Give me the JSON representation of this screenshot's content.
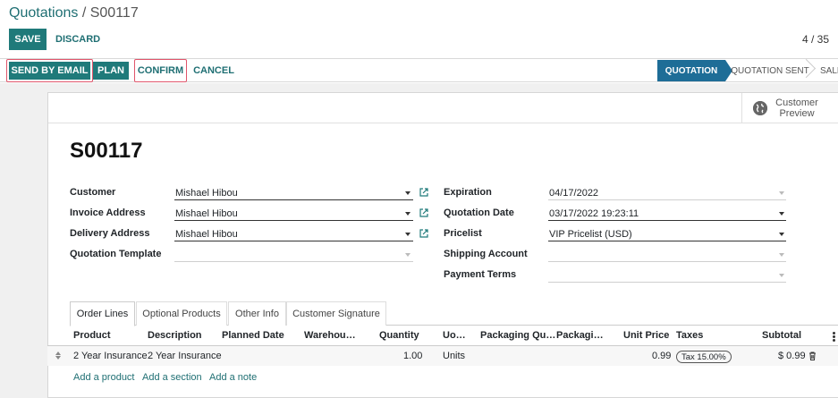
{
  "breadcrumb": {
    "parent": "Quotations",
    "separator": " / ",
    "current": "S00117"
  },
  "control": {
    "save": "SAVE",
    "discard": "DISCARD",
    "pager": "4 / 35"
  },
  "actions": {
    "send_email": "SEND BY EMAIL",
    "plan": "PLAN",
    "confirm": "CONFIRM",
    "cancel": "CANCEL"
  },
  "statusbar": {
    "stages": [
      "QUOTATION",
      "QUOTATION SENT",
      "SALES ORDER"
    ],
    "active": "QUOTATION"
  },
  "preview": {
    "label": "Customer Preview"
  },
  "record": {
    "name": "S00117"
  },
  "fields_left": [
    {
      "label": "Customer",
      "value": "Mishael Hibou"
    },
    {
      "label": "Invoice Address",
      "value": "Mishael Hibou"
    },
    {
      "label": "Delivery Address",
      "value": "Mishael Hibou"
    },
    {
      "label": "Quotation Template",
      "value": ""
    }
  ],
  "fields_right": [
    {
      "label": "Expiration",
      "value": "04/17/2022"
    },
    {
      "label": "Quotation Date",
      "value": "03/17/2022 19:23:11"
    },
    {
      "label": "Pricelist",
      "value": "VIP Pricelist (USD)"
    },
    {
      "label": "Shipping Account",
      "value": ""
    },
    {
      "label": "Payment Terms",
      "value": ""
    }
  ],
  "tabs": [
    "Order Lines",
    "Optional Products",
    "Other Info",
    "Customer Signature"
  ],
  "table": {
    "columns": [
      "Product",
      "Description",
      "Planned Date",
      "Warehou…",
      "Quantity",
      "Uo…",
      "Packaging Qu…",
      "Packagi…",
      "Unit Price",
      "Taxes",
      "Subtotal"
    ],
    "rows": [
      {
        "product": "2 Year Insurance",
        "description": "2 Year Insurance",
        "quantity": "1.00",
        "uom": "Units",
        "unit_price": "0.99",
        "tax": "Tax 15.00%",
        "subtotal": "$ 0.99"
      }
    ],
    "add_links": [
      "Add a product",
      "Add a section",
      "Add a note"
    ]
  },
  "colors": {
    "primary": "#1f7a7a",
    "stage_active": "#1e6d97",
    "highlight": "#e0556b",
    "link": "#1f6f73"
  }
}
